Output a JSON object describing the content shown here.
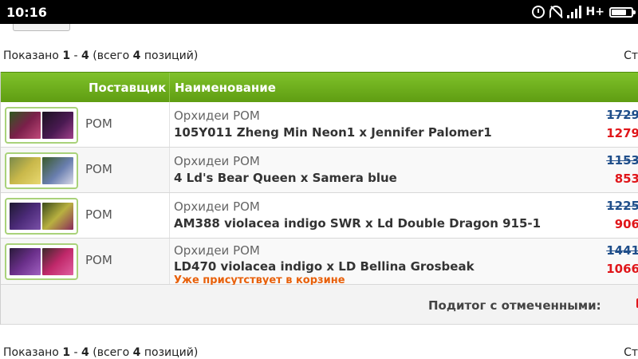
{
  "status_bar": {
    "time": "10:16",
    "network": "H+"
  },
  "pager_top": {
    "prefix": "Показано",
    "from": "1",
    "dash": "-",
    "to": "4",
    "total_prefix": "(всего",
    "total": "4",
    "total_suffix": "позиций)",
    "right": "Ст"
  },
  "pager_bottom": {
    "prefix": "Показано",
    "from": "1",
    "dash": "-",
    "to": "4",
    "total_prefix": "(всего",
    "total": "4",
    "total_suffix": "позиций)",
    "right": "Ст"
  },
  "table": {
    "headers": {
      "supplier": "Поставщик",
      "name": "Наименование"
    },
    "rows": [
      {
        "supplier": "POM",
        "category": "Орхидеи POM",
        "title": "105Y011 Zheng Min Neon1 x Jennifer Palomer1",
        "price_old": "1729",
        "price_new": "1279",
        "in_cart": ""
      },
      {
        "supplier": "POM",
        "category": "Орхидеи POM",
        "title": "4 Ld's Bear Queen x Samera blue",
        "price_old": "1153",
        "price_new": "853",
        "in_cart": ""
      },
      {
        "supplier": "POM",
        "category": "Орхидеи POM",
        "title": "AM388 violacea indigo SWR x Ld Double Dragon 915-1",
        "price_old": "1225",
        "price_new": "906",
        "in_cart": ""
      },
      {
        "supplier": "POM",
        "category": "Орхидеи POM",
        "title": "LD470 violacea indigo x LD Bellina Grosbeak",
        "price_old": "1441",
        "price_new": "1066",
        "in_cart": "Уже присутствует в корзине"
      }
    ],
    "subtotal_label": "Подитог с отмеченными:"
  },
  "colors": {
    "header_green": "#6aab1a",
    "old_price": "#1f4e8a",
    "new_price": "#e0161a",
    "in_cart": "#e8600a"
  },
  "thumbnails": [
    [
      "#7a1f4a",
      "#4a1a52"
    ],
    [
      "#c9b84a",
      "#6a7fb0"
    ],
    [
      "#4b2a78",
      "#b8b040"
    ],
    [
      "#6a2f8a",
      "#c0286a"
    ]
  ]
}
